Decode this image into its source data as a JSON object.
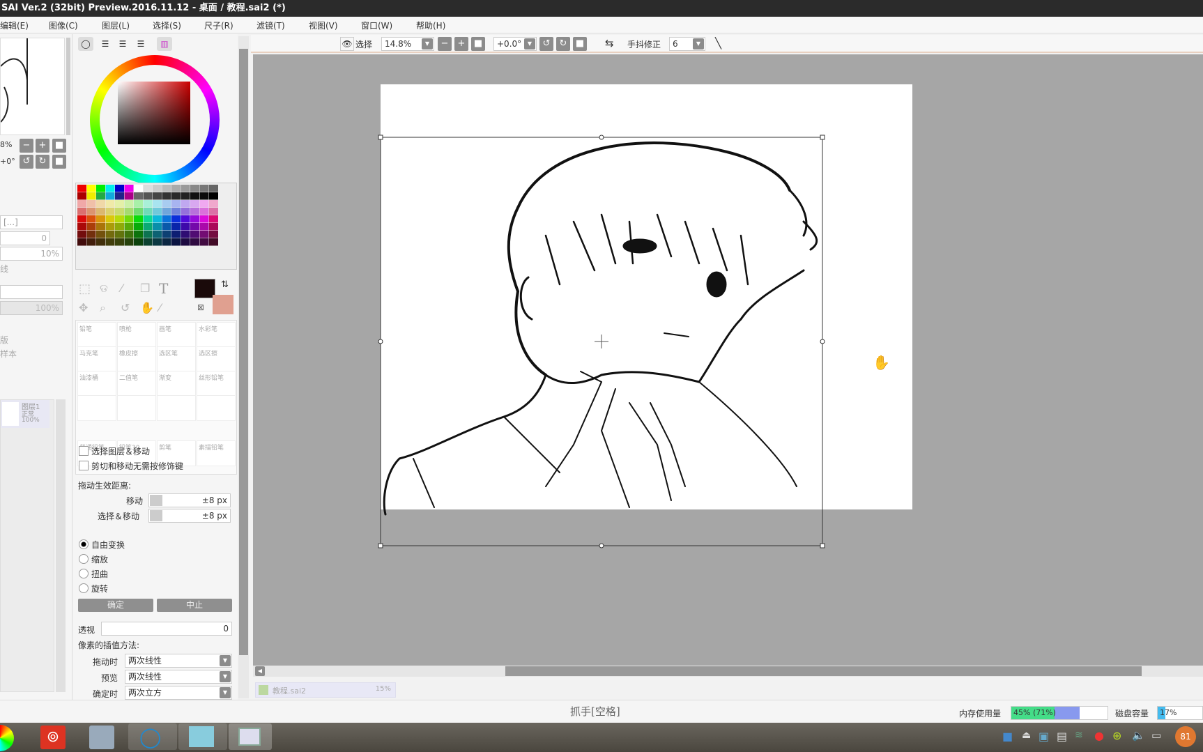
{
  "window": {
    "title": "SAI Ver.2 (32bit) Preview.2016.11.12 - 桌面 / 教程.sai2 (*)"
  },
  "menu": [
    "编辑(E)",
    "图像(C)",
    "图层(L)",
    "选择(S)",
    "尺子(R)",
    "滤镜(T)",
    "视图(V)",
    "窗口(W)",
    "帮助(H)"
  ],
  "navigator": {
    "zoom": "8%",
    "angle": "+0°"
  },
  "layer_props": {
    "blend": "[...]",
    "value1": "0",
    "value2": "10%",
    "label1": "线",
    "mode": "",
    "opacity": "100%",
    "label2": "版",
    "label3": "样本"
  },
  "layer": {
    "name": "图层1",
    "mode": "正常",
    "opacity": "100%"
  },
  "colors": {
    "primary": "#1a0a0a",
    "secondary": "#e0a090"
  },
  "tools": {
    "text_tool": "T"
  },
  "brushes": [
    [
      "铅笔",
      "喷枪",
      "画笔",
      "水彩笔"
    ],
    [
      "马克笔",
      "橡皮擦",
      "选区笔",
      "选区擦"
    ],
    [
      "油漆桶",
      "二值笔",
      "渐变",
      "丝形铅笔"
    ],
    [
      "",
      "",
      "",
      ""
    ],
    [
      "普通铅笔",
      "铅笔30",
      "剪笔",
      "素描铅笔"
    ]
  ],
  "toolbar": {
    "select_label": "选择",
    "zoom": "14.8%",
    "angle": "+0.0°",
    "stabilizer_label": "手抖修正",
    "stabilizer": "6"
  },
  "move_options": {
    "check1": "选择图层＆移动",
    "check2": "剪切和移动无需按修饰键",
    "drag_heading": "拖动生效距离:",
    "move_label": "移动",
    "move_value": "±8 px",
    "selmove_label": "选择＆移动",
    "selmove_value": "±8 px",
    "radios": [
      "自由变换",
      "缩放",
      "扭曲",
      "旋转"
    ],
    "ok": "确定",
    "cancel": "中止",
    "perspective_label": "透视",
    "perspective_value": "0",
    "interp_heading": "像素的插值方法:",
    "drag_label": "拖动时",
    "drag_value": "两次线性",
    "preview_label": "预览",
    "preview_value": "两次线性",
    "confirm_label": "确定时",
    "confirm_value": "两次立方"
  },
  "file_tab": {
    "name": "教程.sai2",
    "zoom": "15%"
  },
  "status": {
    "hint": "抓手[空格]",
    "mem_label": "内存使用量",
    "mem_text": "45% (71%)",
    "mem_fill": 45,
    "mem_fill2": 71,
    "disk_label": "磁盘容量",
    "disk_text": "17%",
    "disk_fill": 17
  },
  "taskbar": {
    "badge": "81"
  }
}
